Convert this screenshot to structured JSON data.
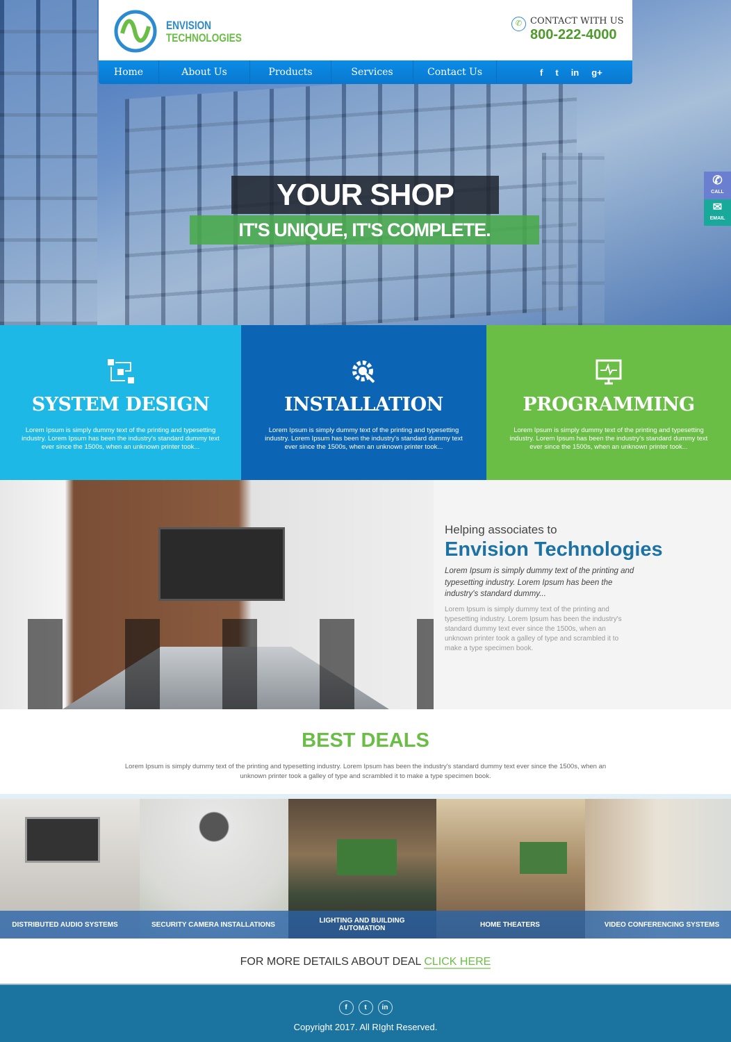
{
  "header": {
    "logo_top": "ENVISION",
    "logo_bottom": "TECHNOLOGIES",
    "contact_label": "CONTACT WITH US",
    "phone": "800-222-4000"
  },
  "nav": {
    "items": [
      "Home",
      "About Us",
      "Products",
      "Services",
      "Contact Us"
    ],
    "social": [
      "f",
      "t",
      "in",
      "g+"
    ]
  },
  "hero": {
    "title": "YOUR SHOP",
    "subtitle": "IT'S UNIQUE, IT'S COMPLETE."
  },
  "side_widget": {
    "call": "CALL",
    "email": "EMAIL"
  },
  "services": [
    {
      "title": "SYSTEM DESIGN",
      "text": "Lorem Ipsum is simply dummy text of the printing and typesetting industry. Lorem Ipsum has been the industry's standard dummy text ever since the 1500s, when an unknown printer took...",
      "color": "#1eb8e6"
    },
    {
      "title": "INSTALLATION",
      "text": "Lorem Ipsum is simply dummy text of the printing and typesetting industry. Lorem Ipsum has been the industry's standard dummy text ever since the 1500s, when an unknown printer took...",
      "color": "#0c64b4"
    },
    {
      "title": "PROGRAMMING",
      "text": "Lorem Ipsum is simply dummy text of the printing and typesetting industry. Lorem Ipsum has been the industry's standard dummy text ever since the 1500s, when an unknown printer took...",
      "color": "#6abd45"
    }
  ],
  "about": {
    "kicker": "Helping associates to",
    "title": "Envision Technologies",
    "italic": "Lorem Ipsum is simply dummy text of the printing and typesetting industry. Lorem Ipsum has been the industry's standard dummy...",
    "body": "Lorem Ipsum is simply dummy text of the printing and typesetting industry. Lorem Ipsum has been the industry's standard dummy text ever since the 1500s, when an unknown printer took a galley of type and scrambled it to make a type specimen book."
  },
  "deals": {
    "title": "BEST DEALS",
    "text": "Lorem Ipsum is simply dummy text of the printing and typesetting industry. Lorem Ipsum has been the industry's standard dummy text ever since the 1500s, when an unknown printer took a galley of type and scrambled it to make a type specimen book.",
    "items": [
      "DISTRIBUTED AUDIO SYSTEMS",
      "SECURITY CAMERA INSTALLATIONS",
      "LIGHTING AND BUILDING AUTOMATION",
      "HOME THEATERS",
      "VIDEO CONFERENCING SYSTEMS"
    ]
  },
  "cta": {
    "text": "FOR MORE DETAILS ABOUT DEAL",
    "link": "CLICK HERE"
  },
  "footer": {
    "social": [
      "f",
      "t",
      "in"
    ],
    "copyright": "Copyright 2017. All RIght Reserved."
  }
}
